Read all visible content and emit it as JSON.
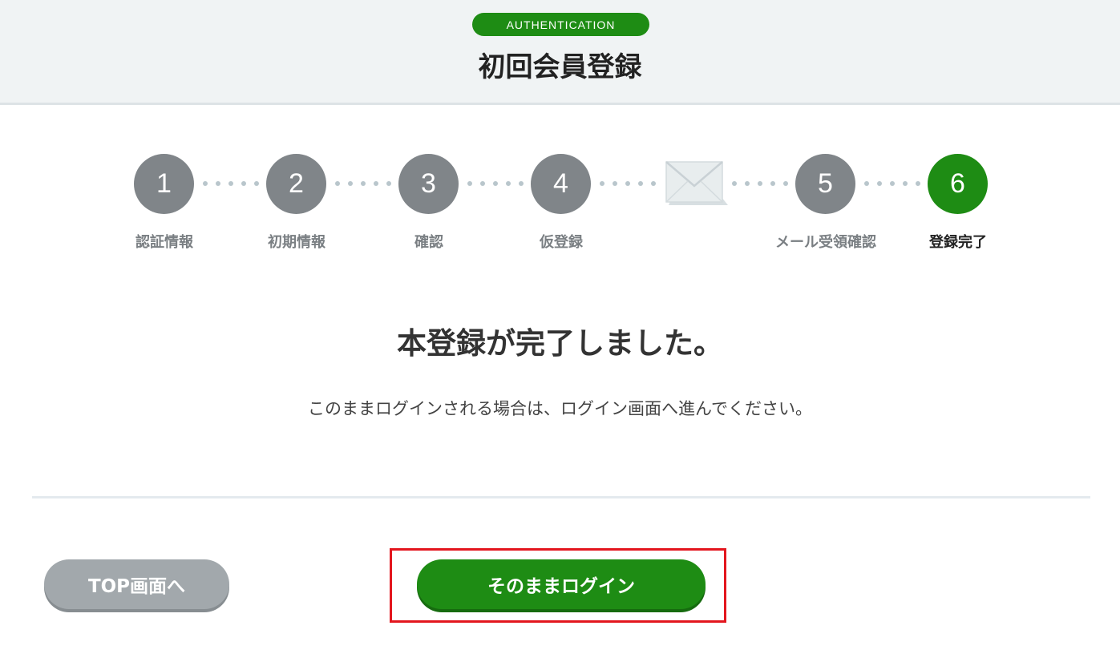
{
  "header": {
    "badge": "AUTHENTICATION",
    "title": "初回会員登録"
  },
  "steps": [
    {
      "number": "1",
      "label": "認証情報"
    },
    {
      "number": "2",
      "label": "初期情報"
    },
    {
      "number": "3",
      "label": "確認"
    },
    {
      "number": "4",
      "label": "仮登録"
    },
    {
      "icon": "mail-icon"
    },
    {
      "number": "5",
      "label": "メール受領確認"
    },
    {
      "number": "6",
      "label": "登録完了",
      "active": true
    }
  ],
  "main": {
    "title": "本登録が完了しました。",
    "message": "このままログインされる場合は、ログイン画面へ進んでください。"
  },
  "buttons": {
    "top_label": "TOP画面へ",
    "login_label": "そのままログイン"
  },
  "colors": {
    "accent": "#1e8c14",
    "step_inactive": "#808589",
    "highlight": "#e3161e"
  }
}
